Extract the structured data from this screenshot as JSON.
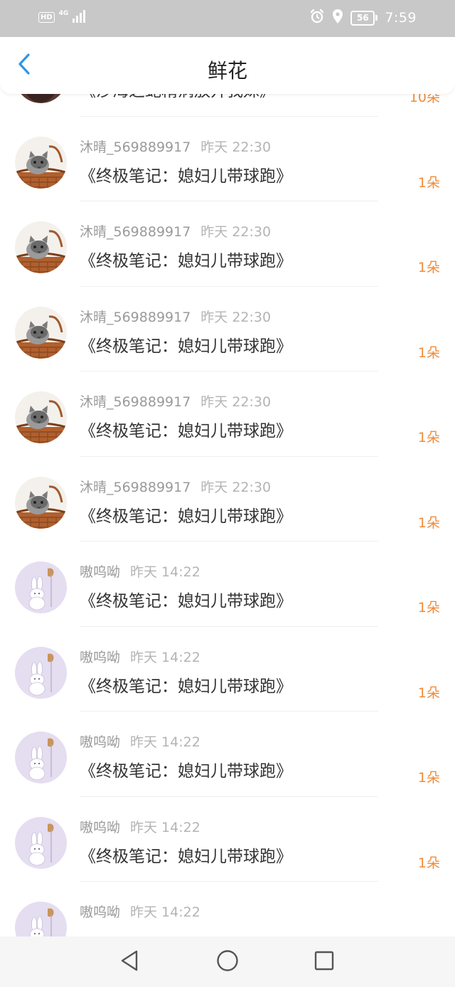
{
  "status_bar": {
    "hd": "HD",
    "network": "4G",
    "battery": "56",
    "time": "7:59"
  },
  "header": {
    "title": "鲜花"
  },
  "list": {
    "items": [
      {
        "user": "",
        "time": "",
        "title": "《沙海之蛇精病放开我妹》",
        "count": "10朵",
        "avatar": "dark"
      },
      {
        "user": "沐晴_569889917",
        "time": "昨天 22:30",
        "title": "《终极笔记：媳妇儿带球跑》",
        "count": "1朵",
        "avatar": "cat"
      },
      {
        "user": "沐晴_569889917",
        "time": "昨天 22:30",
        "title": "《终极笔记：媳妇儿带球跑》",
        "count": "1朵",
        "avatar": "cat"
      },
      {
        "user": "沐晴_569889917",
        "time": "昨天 22:30",
        "title": "《终极笔记：媳妇儿带球跑》",
        "count": "1朵",
        "avatar": "cat"
      },
      {
        "user": "沐晴_569889917",
        "time": "昨天 22:30",
        "title": "《终极笔记：媳妇儿带球跑》",
        "count": "1朵",
        "avatar": "cat"
      },
      {
        "user": "沐晴_569889917",
        "time": "昨天 22:30",
        "title": "《终极笔记：媳妇儿带球跑》",
        "count": "1朵",
        "avatar": "cat"
      },
      {
        "user": "嗷呜呦",
        "time": "昨天 14:22",
        "title": "《终极笔记：媳妇儿带球跑》",
        "count": "1朵",
        "avatar": "bunny"
      },
      {
        "user": "嗷呜呦",
        "time": "昨天 14:22",
        "title": "《终极笔记：媳妇儿带球跑》",
        "count": "1朵",
        "avatar": "bunny"
      },
      {
        "user": "嗷呜呦",
        "time": "昨天 14:22",
        "title": "《终极笔记：媳妇儿带球跑》",
        "count": "1朵",
        "avatar": "bunny"
      },
      {
        "user": "嗷呜呦",
        "time": "昨天 14:22",
        "title": "《终极笔记：媳妇儿带球跑》",
        "count": "1朵",
        "avatar": "bunny"
      },
      {
        "user": "嗷呜呦",
        "time": "昨天 14:22",
        "title": "",
        "count": "",
        "avatar": "bunny"
      }
    ]
  },
  "icons": {
    "back": "chevron-left-icon",
    "nav_back": "triangle-back-icon",
    "nav_home": "circle-home-icon",
    "nav_recents": "square-recents-icon"
  },
  "colors": {
    "accent": "#2f95e8",
    "count": "#f08b3a",
    "status_bar": "#c8c8c8"
  }
}
